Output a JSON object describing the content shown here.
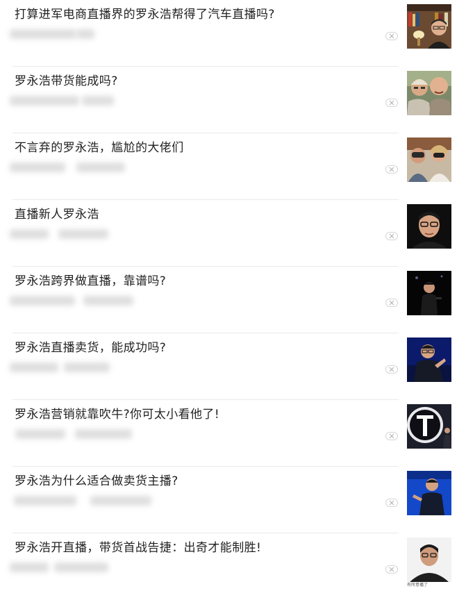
{
  "feed": {
    "items": [
      {
        "title": "打算进军电商直播界的罗永浩帮得了汽车直播吗?",
        "thumb_icon": "photo-man-bookshelf"
      },
      {
        "title": "罗永浩带货能成吗?",
        "thumb_icon": "photo-two-bald-men"
      },
      {
        "title": "不言弃的罗永浩，尴尬的大佬们",
        "thumb_icon": "photo-people-binoculars"
      },
      {
        "title": "直播新人罗永浩",
        "thumb_icon": "photo-man-glasses-dark"
      },
      {
        "title": "罗永浩跨界做直播，靠谱吗?",
        "thumb_icon": "photo-stage-speaker"
      },
      {
        "title": "罗永浩直播卖货，能成功吗?",
        "thumb_icon": "photo-speaker-blue-stage"
      },
      {
        "title": "罗永浩营销就靠吹牛?你可太小看他了!",
        "thumb_icon": "photo-t-logo-stage"
      },
      {
        "title": "罗永浩为什么适合做卖货主播?",
        "thumb_icon": "photo-speaker-blue-background"
      },
      {
        "title": "罗永浩开直播，带货首战告捷：出奇才能制胜!",
        "thumb_icon": "photo-man-portrait-white",
        "thumb_caption": "有所意播了"
      }
    ]
  },
  "colors": {
    "title_text": "#222222",
    "divider": "#e9e9e9",
    "close_border": "#d6d6d6",
    "close_x": "#b5b5b5"
  }
}
